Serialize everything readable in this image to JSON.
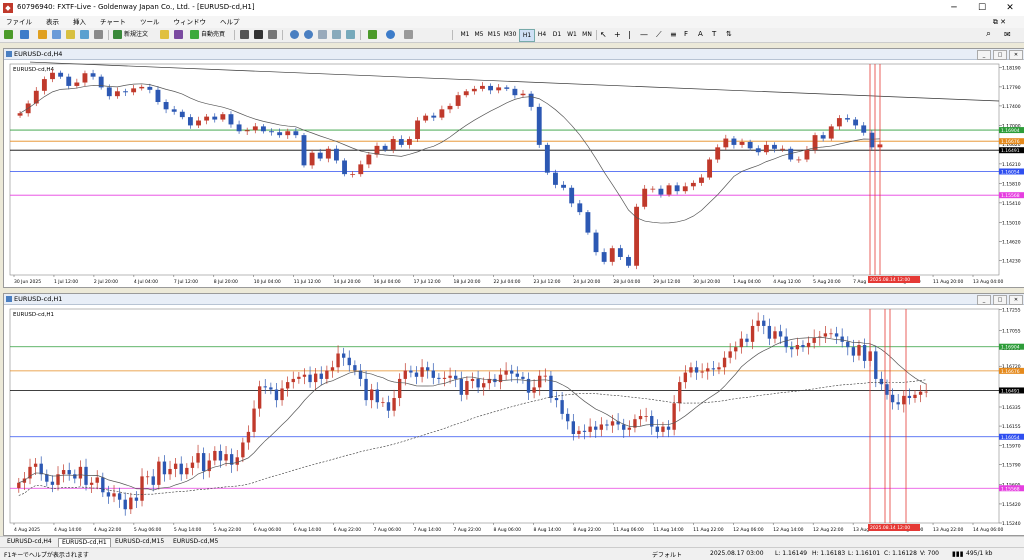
{
  "window": {
    "title": "60796940: FXTF-Live - Goldenway Japan Co., Ltd. - [EURUSD-cd,H1]",
    "app_icon": "mt4-app-icon"
  },
  "menu": [
    "ファイル",
    "表示",
    "挿入",
    "チャート",
    "ツール",
    "ウィンドウ",
    "ヘルプ"
  ],
  "toolbar": {
    "new_order_label": "新規注文",
    "auto_trading_label": "自動売買",
    "timeframes": [
      "M1",
      "M5",
      "M15",
      "M30",
      "H1",
      "H4",
      "D1",
      "W1",
      "MN"
    ]
  },
  "windows": {
    "h4": {
      "title": "EURUSD-cd,H4",
      "label": "EURUSD-cd,H4"
    },
    "h1": {
      "title": "EURUSD-cd,H1",
      "label": "EURUSD-cd,H1"
    }
  },
  "colors": {
    "bull": "#c0392b",
    "bear": "#2c58b3",
    "green": "#2e9d3a",
    "orange": "#e58a1d",
    "blue": "#2f4ff0",
    "magenta": "#e63fe0",
    "black": "#000000",
    "red": "#e53935"
  },
  "tabs": [
    {
      "label": "EURUSD-cd,H4"
    },
    {
      "label": "EURUSD-cd,H1"
    },
    {
      "label": "EURUSD-cd,M15"
    },
    {
      "label": "EURUSD-cd,M5"
    }
  ],
  "status": {
    "help": "F1キーでヘルプが表示されます",
    "profile": "デフォルト",
    "datetime": "2025.08.17 03:00",
    "open": "L: 1.16149",
    "high": "H: 1.16183",
    "low": "L: 1.16101",
    "close": "C: 1.16128",
    "volume": "V: 700",
    "traffic": "495/1 kb"
  },
  "chart_data": [
    {
      "type": "candlestick",
      "title": "EURUSD-cd,H4",
      "ylim": [
        1.1393,
        1.1826
      ],
      "y_ticks": [
        "1.18190",
        "1.17790",
        "1.17400",
        "1.17000",
        "1.16620",
        "1.16210",
        "1.15810",
        "1.15410",
        "1.15010",
        "1.14620",
        "1.14230"
      ],
      "x_ticks": [
        "30 Jun 2025",
        "1 Jul 12:00",
        "2 Jul 20:00",
        "4 Jul 04:00",
        "7 Jul 12:00",
        "8 Jul 20:00",
        "10 Jul 04:00",
        "11 Jul 12:00",
        "14 Jul 20:00",
        "16 Jul 04:00",
        "17 Jul 12:00",
        "18 Jul 20:00",
        "22 Jul 04:00",
        "23 Jul 12:00",
        "24 Jul 20:00",
        "28 Jul 04:00",
        "29 Jul 12:00",
        "30 Jul 20:00",
        "1 Aug 04:00",
        "4 Aug 12:00",
        "5 Aug 20:00",
        "7 Aug 04:00",
        "8 Aug 12:00",
        "11 Aug 20:00",
        "13 Aug 04:00"
      ],
      "hlines": [
        {
          "label": "1.16904",
          "value": 1.16904,
          "color": "green"
        },
        {
          "label": "1.16676",
          "value": 1.16676,
          "color": "orange"
        },
        {
          "label": "1.16491",
          "value": 1.16491,
          "color": "black"
        },
        {
          "label": "1.16054",
          "value": 1.16054,
          "color": "blue"
        },
        {
          "label": "1.15568",
          "value": 1.15568,
          "color": "magenta"
        }
      ],
      "vline_label": "2025.08.14 12:00",
      "trendline": {
        "start": 1.183,
        "end": 1.175
      },
      "close_series": [
        1.1725,
        1.1745,
        1.1771,
        1.1795,
        1.1808,
        1.18,
        1.1781,
        1.1788,
        1.1807,
        1.18,
        1.1778,
        1.176,
        1.177,
        1.1768,
        1.1776,
        1.1779,
        1.1773,
        1.1748,
        1.1733,
        1.1728,
        1.1717,
        1.17,
        1.171,
        1.1718,
        1.1712,
        1.1723,
        1.1702,
        1.1688,
        1.169,
        1.1698,
        1.1688,
        1.1686,
        1.168,
        1.1688,
        1.168,
        1.1618,
        1.1644,
        1.1632,
        1.1652,
        1.1628,
        1.16,
        1.16,
        1.162,
        1.164,
        1.1658,
        1.165,
        1.1672,
        1.166,
        1.1672,
        1.171,
        1.172,
        1.1716,
        1.1733,
        1.174,
        1.1762,
        1.177,
        1.1775,
        1.1781,
        1.1772,
        1.1778,
        1.1775,
        1.1762,
        1.1765,
        1.1738,
        1.166,
        1.1603,
        1.1578,
        1.1572,
        1.154,
        1.1522,
        1.148,
        1.144,
        1.142,
        1.1448,
        1.143,
        1.1412,
        1.1533,
        1.157,
        1.157,
        1.1558,
        1.1577,
        1.1565,
        1.1575,
        1.1582,
        1.1593,
        1.163,
        1.1655,
        1.1673,
        1.166,
        1.1666,
        1.1653,
        1.1645,
        1.166,
        1.1652,
        1.1652,
        1.163,
        1.163,
        1.165,
        1.168,
        1.1673,
        1.1698,
        1.1715,
        1.1712,
        1.17,
        1.1685,
        1.1655,
        1.1661
      ]
    },
    {
      "type": "candlestick",
      "title": "EURUSD-cd,H1",
      "ylim": [
        1.1524,
        1.1726
      ],
      "y_ticks": [
        "1.17255",
        "1.17055",
        "1.16890",
        "1.16720",
        "1.16505",
        "1.16335",
        "1.16155",
        "1.15970",
        "1.15790",
        "1.15605",
        "1.15420",
        "1.15240"
      ],
      "x_ticks": [
        "4 Aug 2025",
        "4 Aug 14:00",
        "4 Aug 22:00",
        "5 Aug 06:00",
        "5 Aug 14:00",
        "5 Aug 22:00",
        "6 Aug 06:00",
        "6 Aug 14:00",
        "6 Aug 22:00",
        "7 Aug 06:00",
        "7 Aug 14:00",
        "7 Aug 22:00",
        "8 Aug 06:00",
        "8 Aug 14:00",
        "8 Aug 22:00",
        "11 Aug 06:00",
        "11 Aug 14:00",
        "11 Aug 22:00",
        "12 Aug 06:00",
        "12 Aug 14:00",
        "12 Aug 22:00",
        "13 Aug 06:00",
        "13 Aug 14:00",
        "13 Aug 22:00",
        "14 Aug 06:00"
      ],
      "hlines": [
        {
          "label": "1.16904",
          "value": 1.16904,
          "color": "green"
        },
        {
          "label": "1.16676",
          "value": 1.16676,
          "color": "orange"
        },
        {
          "label": "1.16491",
          "value": 1.16491,
          "color": "black"
        },
        {
          "label": "1.16054",
          "value": 1.16054,
          "color": "blue"
        },
        {
          "label": "1.15568",
          "value": 1.15568,
          "color": "magenta"
        }
      ],
      "vline_label": "2025.08.14 12:00",
      "close_series": [
        1.1562,
        1.1566,
        1.1577,
        1.158,
        1.157,
        1.1563,
        1.156,
        1.157,
        1.1574,
        1.157,
        1.1566,
        1.1577,
        1.156,
        1.1562,
        1.1567,
        1.1553,
        1.1549,
        1.1552,
        1.1546,
        1.1537,
        1.1548,
        1.1545,
        1.1568,
        1.1568,
        1.156,
        1.1582,
        1.157,
        1.1575,
        1.158,
        1.157,
        1.1576,
        1.1581,
        1.159,
        1.1573,
        1.1583,
        1.1592,
        1.1583,
        1.1589,
        1.1579,
        1.1586,
        1.16,
        1.161,
        1.1632,
        1.1653,
        1.1652,
        1.165,
        1.164,
        1.1651,
        1.1657,
        1.166,
        1.1662,
        1.1664,
        1.1657,
        1.1665,
        1.166,
        1.1668,
        1.1671,
        1.1684,
        1.168,
        1.1673,
        1.1668,
        1.166,
        1.164,
        1.165,
        1.1638,
        1.1638,
        1.163,
        1.1642,
        1.166,
        1.1668,
        1.1666,
        1.1662,
        1.1671,
        1.1668,
        1.1661,
        1.166,
        1.1661,
        1.1663,
        1.166,
        1.1645,
        1.1658,
        1.166,
        1.1652,
        1.1656,
        1.166,
        1.1657,
        1.1664,
        1.1668,
        1.1665,
        1.1662,
        1.166,
        1.1647,
        1.1652,
        1.1663,
        1.1663,
        1.1642,
        1.164,
        1.1627,
        1.162,
        1.1608,
        1.1611,
        1.161,
        1.1615,
        1.1612,
        1.1617,
        1.1616,
        1.162,
        1.1617,
        1.1612,
        1.1614,
        1.1622,
        1.1625,
        1.1625,
        1.1615,
        1.161,
        1.1615,
        1.1612,
        1.1637,
        1.1657,
        1.1666,
        1.1671,
        1.1666,
        1.1667,
        1.167,
        1.1669,
        1.1671,
        1.168,
        1.1686,
        1.169,
        1.1698,
        1.1695,
        1.171,
        1.1715,
        1.171,
        1.1698,
        1.1705,
        1.17,
        1.169,
        1.1688,
        1.1692,
        1.169,
        1.1694,
        1.1699,
        1.17,
        1.1703,
        1.1703,
        1.17,
        1.1695,
        1.169,
        1.1682,
        1.1692,
        1.1677,
        1.1686,
        1.166,
        1.1655,
        1.1645,
        1.1638,
        1.1636,
        1.1644,
        1.1642,
        1.1645,
        1.1648,
        1.1648
      ]
    }
  ]
}
